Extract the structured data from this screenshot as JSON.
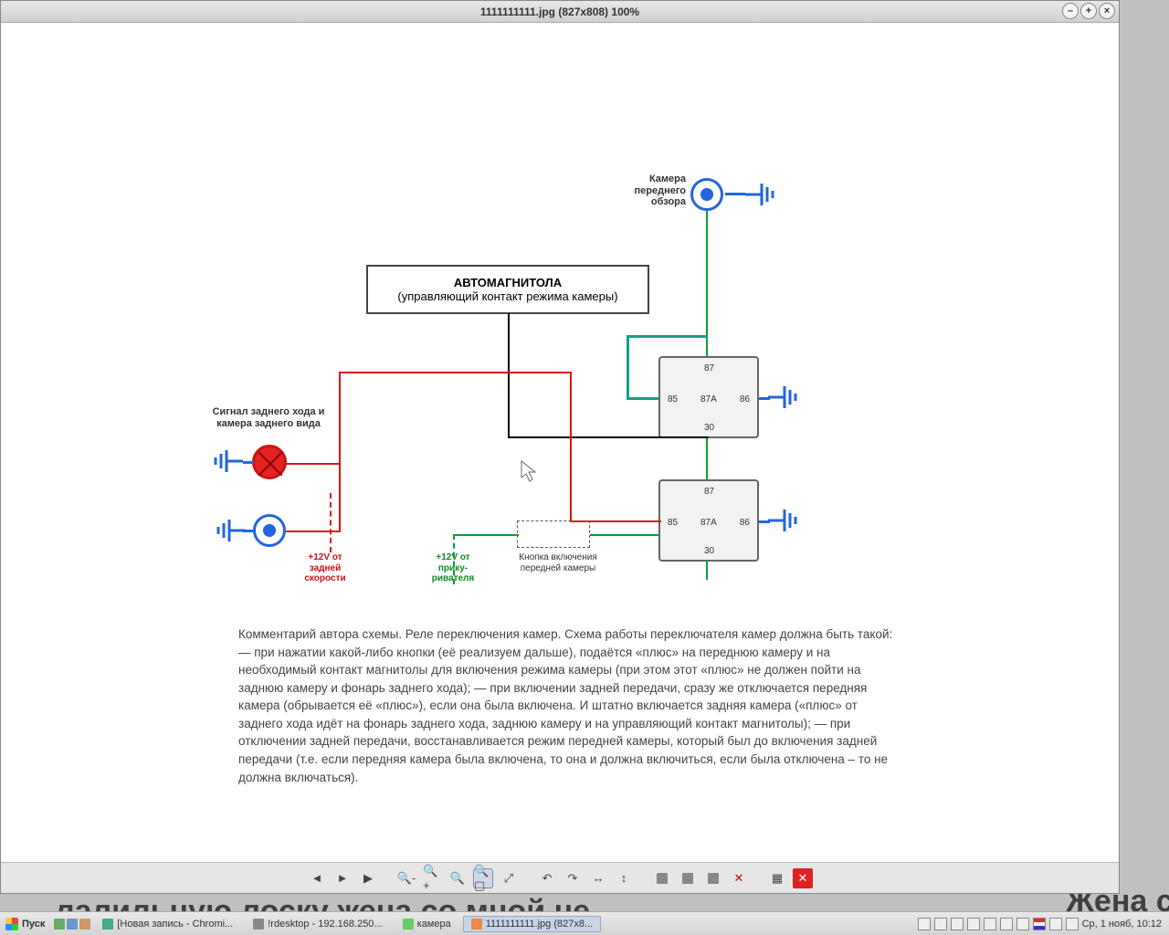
{
  "window": {
    "title": "1111111111.jpg (827x808) 100%"
  },
  "diagram": {
    "stereo_title": "АВТОМАГНИТОЛА",
    "stereo_sub": "(управляющий контакт режима камеры)",
    "front_cam_label": "Камера переднего обзора",
    "rear_cam_label": "Сигнал заднего хода и камера заднего вида",
    "switch_label": "Кнопка включения передней камеры",
    "power_rear": "+12V от задней скорости",
    "power_lighter": "+12V от прику-ривателя",
    "relay_pins": {
      "p87": "87",
      "p87a": "87A",
      "p85": "85",
      "p86": "86",
      "p30": "30"
    }
  },
  "description": "Комментарий автора схемы. Реле переключения камер. Схема работы переключателя камер должна быть такой: — при нажатии какой-либо кнопки (её реализуем дальше), подаётся «плюс» на переднюю камеру и на необходимый контакт магнитолы для включения режима камеры (при этом этот «плюс» не должен пойти на заднюю камеру и фонарь заднего хода); — при включении задней передачи, сразу же отключается передняя камера (обрывается её «плюс»), если она была включена. И штатно включается задняя камера («плюс» от заднего хода идёт на фонарь заднего хода, заднюю камеру и на управляющий контакт магнитолы); — при отключении задней передачи, восстанавливается режим передней камеры, который был до включения задней передачи (т.е. если передняя камера была включена, то она и должна включиться, если была отключена – то не должна включаться).",
  "taskbar": {
    "start": "Пуск",
    "items": [
      "[Новая запись - Chromi...",
      "!rdesktop - 192.168.250...",
      "камера",
      "1111111111.jpg (827x8..."
    ],
    "clock": "Ср, 1 нояб, 10:12"
  },
  "bg_text_left": "лалильную лоску  жена со мной не",
  "bg_text_right": "Жена со м"
}
